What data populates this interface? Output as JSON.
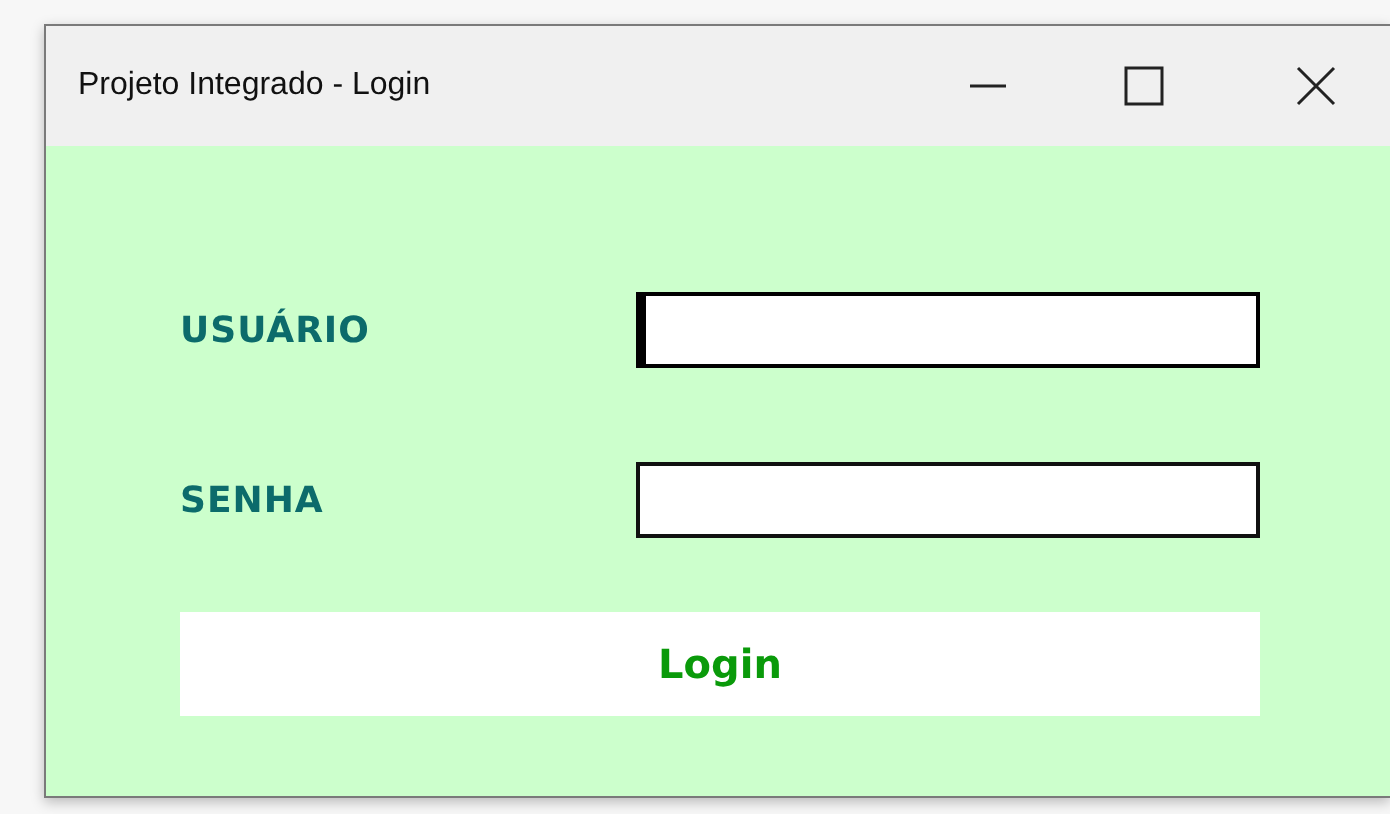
{
  "window": {
    "title": "Projeto Integrado - Login"
  },
  "fields": [
    {
      "label": "USUÁRIO",
      "focused": true
    },
    {
      "label": "SENHA",
      "focused": false
    }
  ],
  "buttons": [
    "Login"
  ]
}
